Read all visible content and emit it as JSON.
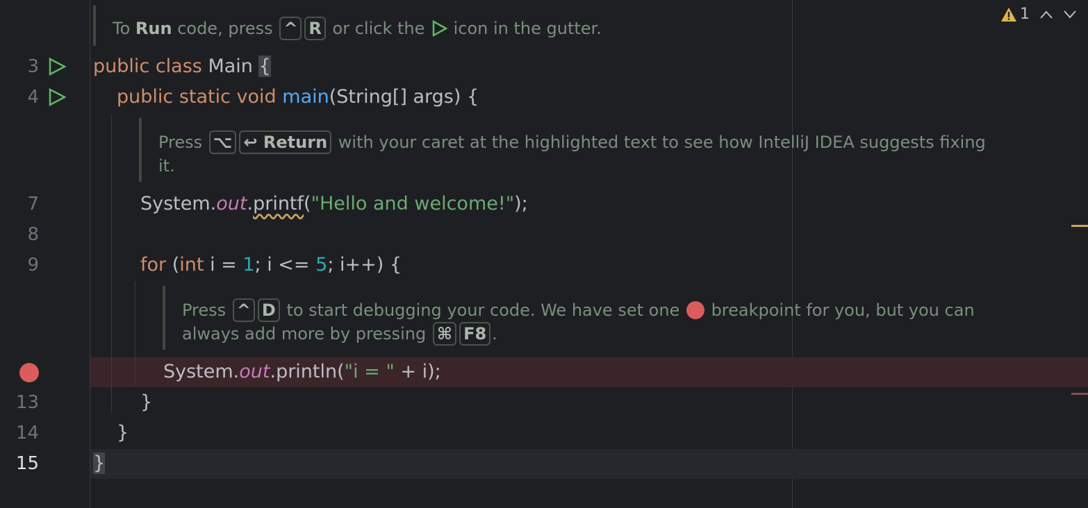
{
  "hints": {
    "run": {
      "prefix": "To ",
      "bold": "Run",
      "mid": " code, press ",
      "key1": "^",
      "key2": "R",
      "suffix1": " or click the ",
      "suffix2": " icon in the gutter."
    },
    "fix": {
      "prefix": "Press ",
      "key1": "⌥",
      "key2": "↩ Return",
      "line1": " with your caret at the highlighted text to see how IntelliJ IDEA suggests fixing",
      "line2": "it."
    },
    "debug": {
      "prefix": "Press ",
      "key1": "^",
      "key2": "D",
      "mid": " to start debugging your code. We have set one ",
      "suffix": " breakpoint for you, but you can",
      "line2": "always add more by pressing ",
      "key3": "⌘",
      "key4": "F8",
      "end": "."
    }
  },
  "line_numbers": {
    "l3": "3",
    "l4": "4",
    "l7": "7",
    "l8": "8",
    "l9": "9",
    "l13": "13",
    "l14": "14",
    "l15": "15"
  },
  "code": {
    "l3": {
      "kw": "public class ",
      "name": "Main ",
      "brace": "{"
    },
    "l4": {
      "kw": "public static void ",
      "fn": "main",
      "rest": "(String[] args) {"
    },
    "l7": {
      "a": "System.",
      "fld": "out",
      ".": ".",
      "method": "printf",
      "b": "(",
      "str": "\"Hello and welcome!\"",
      "c": ");"
    },
    "l9": {
      "kw": "for ",
      "p1": "(",
      "kw2": "int ",
      "v": "i = ",
      "n1": "1",
      "p2": "; i <= ",
      "n2": "5",
      "p3": "; i++) {"
    },
    "l12": {
      "a": "System.",
      "fld": "out",
      "b": ".println(",
      "str": "\"i = \"",
      "c": " + i);"
    },
    "l13": "}",
    "l14": "}",
    "l15": "}"
  },
  "inspection": {
    "warnings": "1"
  },
  "colors": {
    "breakpoint": "#db5c5c",
    "run": "#5fb865",
    "warning": "#e0b64a"
  }
}
